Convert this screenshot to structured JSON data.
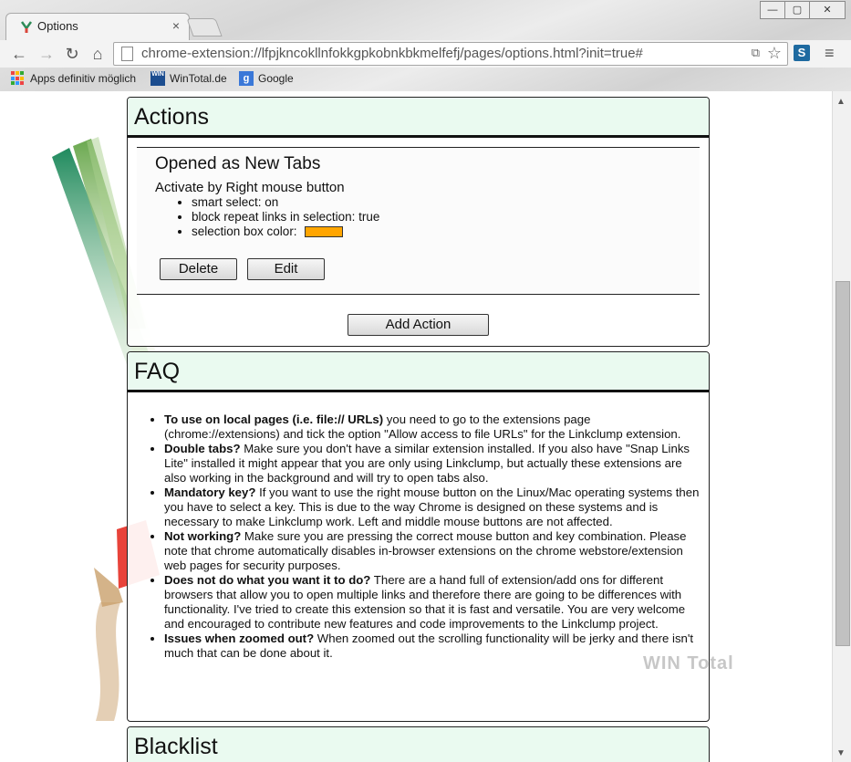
{
  "browser": {
    "tab_title": "Options",
    "tab_close": "×",
    "window_buttons": {
      "minimize": "—",
      "maximize": "▢",
      "close": "✕"
    },
    "nav": {
      "back": "←",
      "forward": "→",
      "reload": "↻",
      "home": "⌂"
    },
    "url": "chrome-extension://lfpjkncokllnfokkgpkobnkbkmelfefj/pages/options.html?init=true#",
    "translate_glyph": "⧉",
    "star": "☆",
    "extension_badge": "S",
    "menu": "≡",
    "bookmarks": [
      {
        "label": "Apps definitiv möglich",
        "icon": "apps-grid-icon"
      },
      {
        "label": "WinTotal.de",
        "icon": "wintotal-icon"
      },
      {
        "label": "Google",
        "icon": "google-icon"
      }
    ],
    "wintotal_icon_text": "WIN",
    "google_icon_text": "g"
  },
  "actions": {
    "heading": "Actions",
    "item": {
      "title": "Opened as New Tabs",
      "activate": "Activate by Right mouse button",
      "settings": [
        "smart select: on",
        "block repeat links in selection: true",
        "selection box color:"
      ],
      "selection_color": "#ffa500",
      "delete_label": "Delete",
      "edit_label": "Edit"
    },
    "add_label": "Add Action"
  },
  "faq": {
    "heading": "FAQ",
    "items": [
      {
        "q": "To use on local pages (i.e. file:// URLs)",
        "a": " you need to go to the extensions page (chrome://extensions) and tick the option \"Allow access to file URLs\" for the Linkclump extension."
      },
      {
        "q": "Double tabs?",
        "a": " Make sure you don't have a similar extension installed. If you also have \"Snap Links Lite\" installed it might appear that you are only using Linkclump, but actually these extensions are also working in the background and will try to open tabs also."
      },
      {
        "q": "Mandatory key?",
        "a": " If you want to use the right mouse button on the Linux/Mac operating systems then you have to select a key. This is due to the way Chrome is designed on these systems and is necessary to make Linkclump work. Left and middle mouse buttons are not affected."
      },
      {
        "q": "Not working?",
        "a": " Make sure you are pressing the correct mouse button and key combination. Please note that chrome automatically disables in-browser extensions on the chrome webstore/extension web pages for security purposes."
      },
      {
        "q": "Does not do what you want it to do?",
        "a": " There are a hand full of extension/add ons for different browsers that allow you to open multiple links and therefore there are going to be differences with functionality. I've tried to create this extension so that it is fast and versatile. You are very welcome and encouraged to contribute new features and code improvements to the Linkclump project."
      },
      {
        "q": "Issues when zoomed out?",
        "a": " When zoomed out the scrolling functionality will be jerky and there isn't much that can be done about it."
      }
    ]
  },
  "blacklist": {
    "heading": "Blacklist"
  },
  "watermark": "WIN Total",
  "scrollbar": {
    "up": "▲",
    "down": "▼"
  }
}
